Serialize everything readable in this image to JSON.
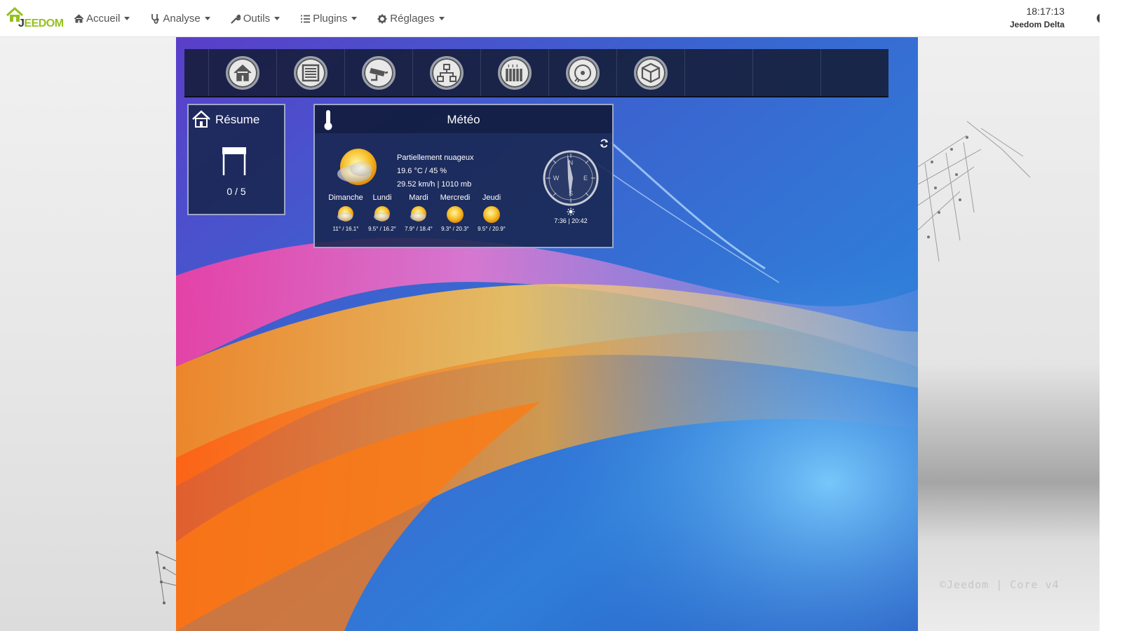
{
  "navbar": {
    "brand": "EEDOM",
    "brand_initial": "J",
    "menus": [
      {
        "label": "Accueil",
        "icon": "home-icon"
      },
      {
        "label": "Analyse",
        "icon": "stethoscope-icon"
      },
      {
        "label": "Outils",
        "icon": "wrench-icon"
      },
      {
        "label": "Plugins",
        "icon": "list-icon"
      },
      {
        "label": "Réglages",
        "icon": "gear-icon"
      }
    ],
    "clock": "18:17:13",
    "system_name": "Jeedom Delta",
    "help_label": "?"
  },
  "object_bar": {
    "buttons": [
      {
        "icon": "home-icon"
      },
      {
        "icon": "shutter-icon"
      },
      {
        "icon": "camera-icon"
      },
      {
        "icon": "network-icon"
      },
      {
        "icon": "radiator-icon"
      },
      {
        "icon": "media-icon"
      },
      {
        "icon": "box-icon"
      }
    ]
  },
  "resume": {
    "title": "Résume",
    "count": "0 / 5"
  },
  "meteo": {
    "title": "Météo",
    "condition": "Partiellement nuageux",
    "temp_humidity": "19.6 °C / 45 %",
    "wind_pressure": "29.52 km/h | 1010 mb",
    "forecast": [
      {
        "day": "Dimanche",
        "temps": "11° / 16.1°",
        "icon": "partly-cloudy-icon"
      },
      {
        "day": "Lundi",
        "temps": "9.5° / 16.2°",
        "icon": "partly-cloudy-icon"
      },
      {
        "day": "Mardi",
        "temps": "7.9° / 18.4°",
        "icon": "partly-cloudy-icon"
      },
      {
        "day": "Mercredi",
        "temps": "9.3° / 20.3°",
        "icon": "sun-icon"
      },
      {
        "day": "Jeudi",
        "temps": "9.5° / 20.9°",
        "icon": "sun-icon"
      }
    ],
    "compass_letters": {
      "n": "N",
      "e": "E",
      "s": "S",
      "w": "W"
    },
    "sun_times": "7:36 | 20:42"
  },
  "footer": {
    "copyright": "©Jeedom | Core v4"
  },
  "colors": {
    "brand_green": "#94c11f",
    "widget_bg": "#18264e",
    "navbar_bg": "#ffffff"
  }
}
